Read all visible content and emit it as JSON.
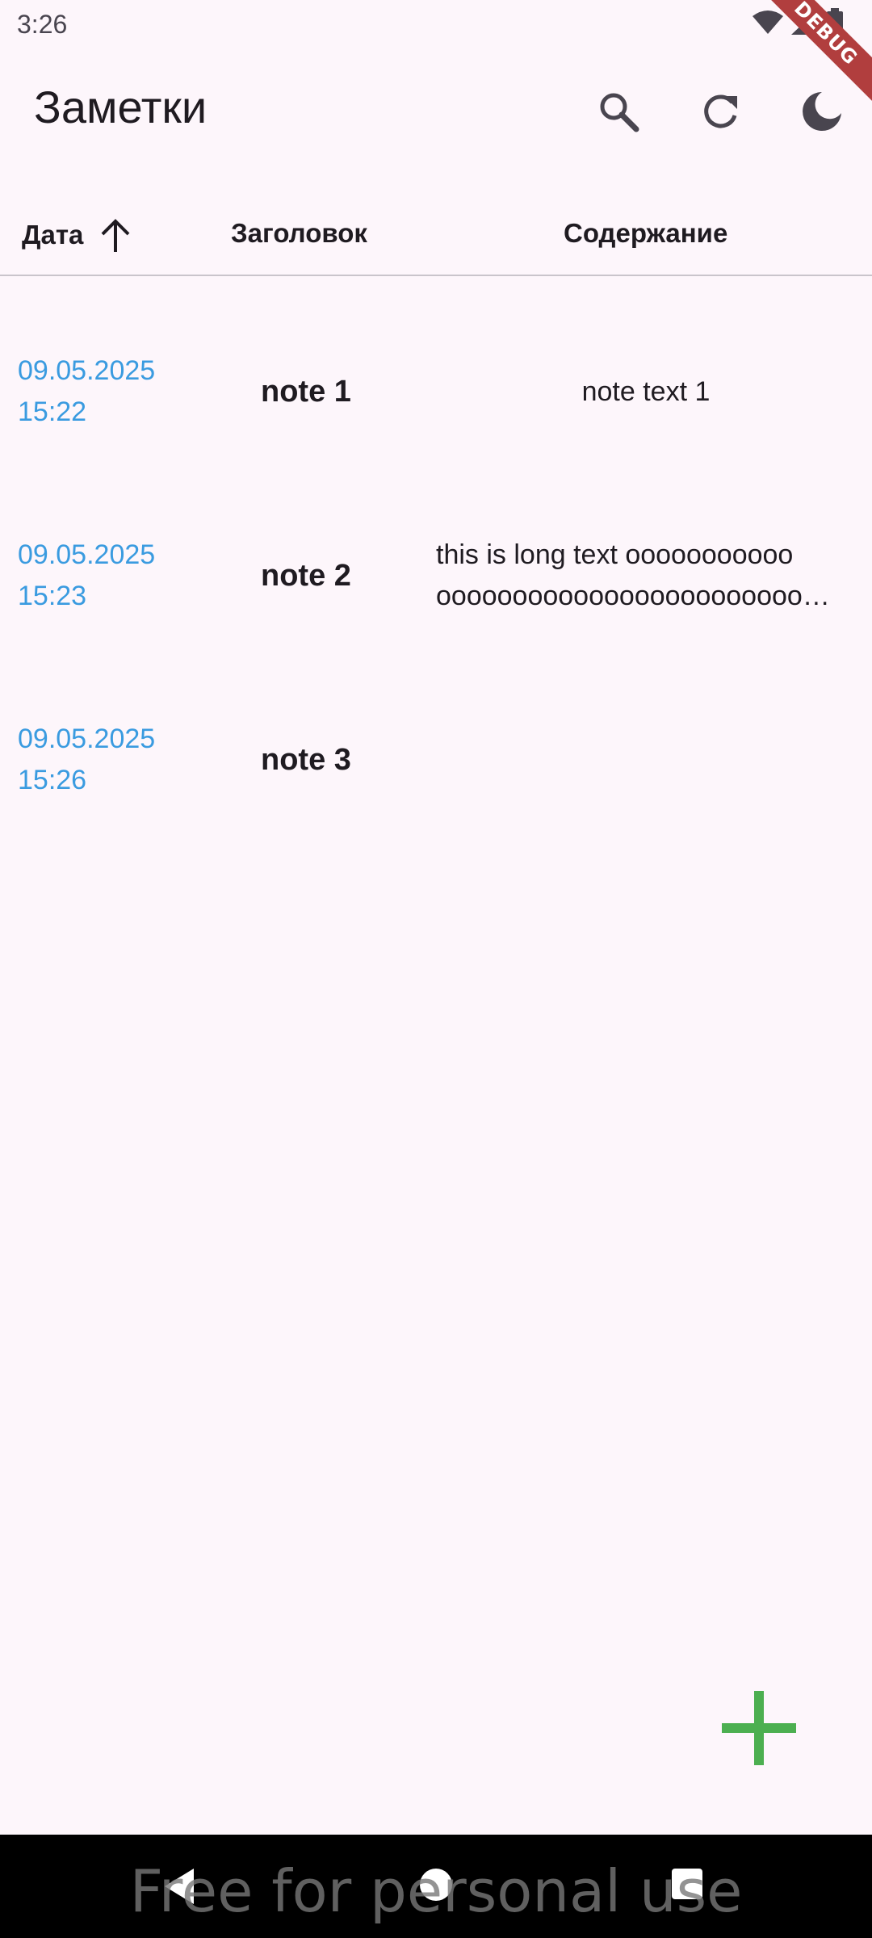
{
  "status_bar": {
    "time": "3:26"
  },
  "debug_banner": "DEBUG",
  "app_bar": {
    "title": "Заметки",
    "actions": [
      "search-icon",
      "refresh-icon",
      "dark-mode-icon"
    ]
  },
  "table": {
    "headers": {
      "date": "Дата",
      "title": "Заголовок",
      "content": "Содержание"
    },
    "sort_indicator": "arrow-up-icon",
    "rows": [
      {
        "date": "09.05.2025",
        "time": "15:22",
        "title": "note 1",
        "content_line1": "note text 1",
        "content_line2": ""
      },
      {
        "date": "09.05.2025",
        "time": "15:23",
        "title": "note 2",
        "content_line1": "this is long text ooooooooooo",
        "content_line2": "oooooooooooooooooooooooo…"
      },
      {
        "date": "09.05.2025",
        "time": "15:26",
        "title": "note 3",
        "content_line1": "",
        "content_line2": ""
      }
    ]
  },
  "fab": {
    "icon": "plus-icon",
    "color": "#4caf50"
  },
  "watermark": "Free for personal use",
  "colors": {
    "date": "#3a9be0",
    "background": "#fdf6fb",
    "banner": "#b13e3e"
  }
}
